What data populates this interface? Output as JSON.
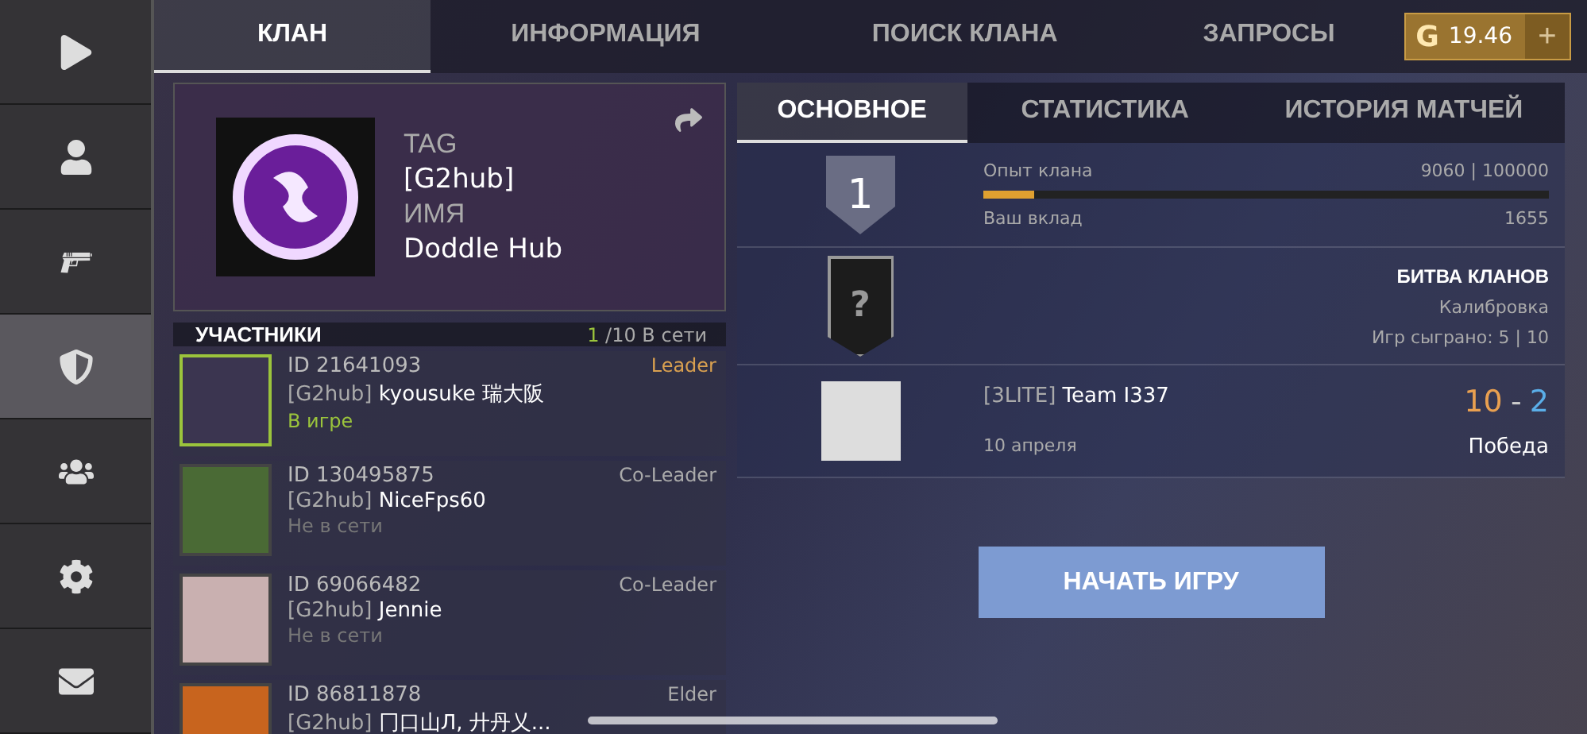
{
  "sidebar": {
    "items": [
      {
        "kind": "play",
        "selected": false
      },
      {
        "kind": "profile",
        "selected": false
      },
      {
        "kind": "gun",
        "selected": false
      },
      {
        "kind": "shield",
        "selected": true
      },
      {
        "kind": "friends",
        "selected": false
      },
      {
        "kind": "settings",
        "selected": false
      },
      {
        "kind": "mail",
        "selected": false
      }
    ]
  },
  "tabs": [
    {
      "label": "КЛАН",
      "selected": true
    },
    {
      "label": "ИНФОРМАЦИЯ",
      "selected": false
    },
    {
      "label": "ПОИСК КЛАНА",
      "selected": false
    },
    {
      "label": "ЗАПРОСЫ",
      "selected": false
    }
  ],
  "currency": {
    "symbol": "G",
    "amount": "19.46",
    "add": "+"
  },
  "clan_card": {
    "tag_label": "TAG",
    "tag": "[G2hub]",
    "name_label": "ИМЯ",
    "name": "Doddle Hub"
  },
  "members": {
    "title": "УЧАСТНИКИ",
    "online_count": "1",
    "online_total": "/10 В сети",
    "rows": [
      {
        "id": "ID 21641093",
        "tag": "[G2hub]",
        "name": "kyousuke 瑞大阪",
        "role": "Leader",
        "leader": true,
        "status": "В игре",
        "online": true
      },
      {
        "id": "ID 130495875",
        "tag": "[G2hub]",
        "name": "NiceFps60",
        "role": "Co-Leader",
        "leader": false,
        "status": "Не в сети",
        "online": false
      },
      {
        "id": "ID 69066482",
        "tag": "[G2hub]",
        "name": "Jennie",
        "role": "Co-Leader",
        "leader": false,
        "status": "Не в сети",
        "online": false
      },
      {
        "id": "ID 86811878",
        "tag": "[G2hub]",
        "name": "冂口山Л, 廾丹乂...",
        "role": "Elder",
        "leader": false,
        "online": false
      }
    ]
  },
  "info_tabs": [
    {
      "label": "ОСНОВНОЕ",
      "selected": true
    },
    {
      "label": "СТАТИСТИКА",
      "selected": false
    },
    {
      "label": "ИСТОРИЯ МАТЧЕЙ",
      "selected": false
    }
  ],
  "experience": {
    "rank": "1",
    "label": "Опыт клана",
    "value": "9060 | 100000",
    "level": 0.0906,
    "contribution_label": "Ваш вклад",
    "contribution": "1655"
  },
  "battle": {
    "badge": "?",
    "title": "БИТВА КЛАНОВ",
    "status": "Калибровка",
    "games": "Игр сыграно: 5 | 10"
  },
  "last_match": {
    "tag": "[3LITE]",
    "team": "Team I337",
    "date": "10 апреля",
    "score_own": "10",
    "separator": "-",
    "score_enemy": "2",
    "result": "Победа"
  },
  "start_button": "НАЧАТЬ ИГРУ"
}
